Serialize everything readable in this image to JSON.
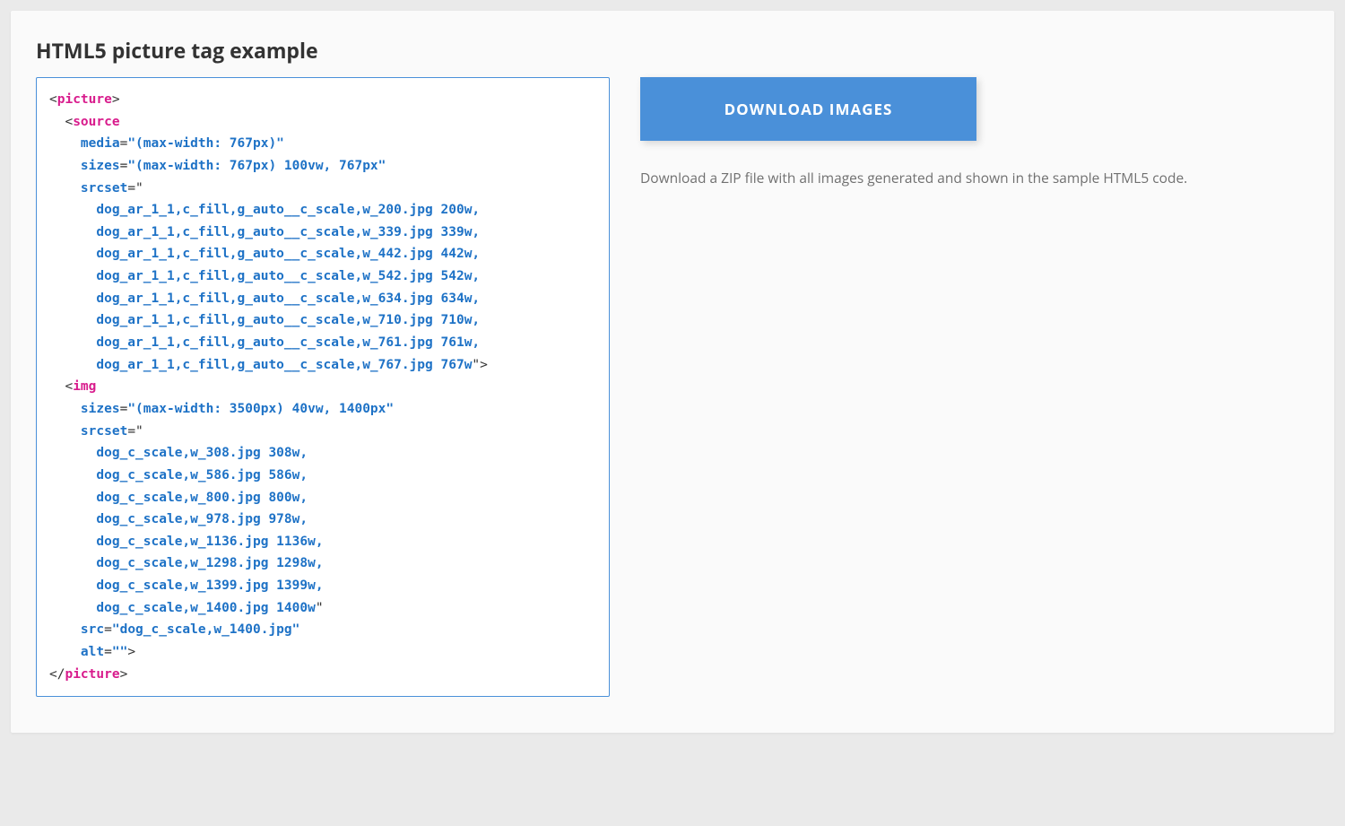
{
  "header": {
    "title": "HTML5 picture tag example"
  },
  "code": {
    "picture_tag": "picture",
    "source_tag": "source",
    "img_tag": "img",
    "source": {
      "media_attr": "media",
      "media_val": "\"(max-width: 767px)\"",
      "sizes_attr": "sizes",
      "sizes_val": "\"(max-width: 767px) 100vw, 767px\"",
      "srcset_attr": "srcset",
      "srcset_open": "=\"",
      "srcset_lines": [
        "dog_ar_1_1,c_fill,g_auto__c_scale,w_200.jpg 200w,",
        "dog_ar_1_1,c_fill,g_auto__c_scale,w_339.jpg 339w,",
        "dog_ar_1_1,c_fill,g_auto__c_scale,w_442.jpg 442w,",
        "dog_ar_1_1,c_fill,g_auto__c_scale,w_542.jpg 542w,",
        "dog_ar_1_1,c_fill,g_auto__c_scale,w_634.jpg 634w,",
        "dog_ar_1_1,c_fill,g_auto__c_scale,w_710.jpg 710w,",
        "dog_ar_1_1,c_fill,g_auto__c_scale,w_761.jpg 761w,"
      ],
      "srcset_last": "dog_ar_1_1,c_fill,g_auto__c_scale,w_767.jpg 767w",
      "srcset_close": "\">"
    },
    "img": {
      "sizes_attr": "sizes",
      "sizes_val": "\"(max-width: 3500px) 40vw, 1400px\"",
      "srcset_attr": "srcset",
      "srcset_open": "=\"",
      "srcset_lines": [
        "dog_c_scale,w_308.jpg 308w,",
        "dog_c_scale,w_586.jpg 586w,",
        "dog_c_scale,w_800.jpg 800w,",
        "dog_c_scale,w_978.jpg 978w,",
        "dog_c_scale,w_1136.jpg 1136w,",
        "dog_c_scale,w_1298.jpg 1298w,",
        "dog_c_scale,w_1399.jpg 1399w,"
      ],
      "srcset_last": "dog_c_scale,w_1400.jpg 1400w",
      "srcset_close": "\"",
      "src_attr": "src",
      "src_val": "\"dog_c_scale,w_1400.jpg\"",
      "alt_attr": "alt",
      "alt_val": "\"\""
    }
  },
  "right": {
    "button_label": "DOWNLOAD IMAGES",
    "description": "Download a ZIP file with all images generated and shown in the sample HTML5 code."
  }
}
